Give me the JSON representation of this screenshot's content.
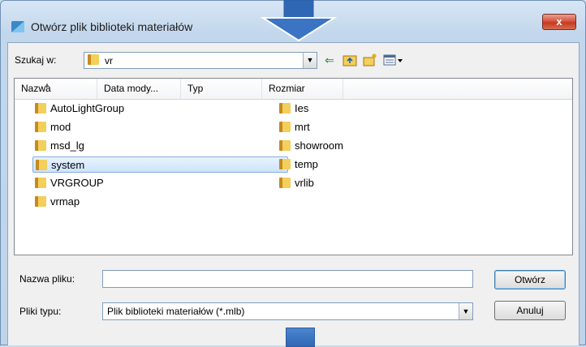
{
  "window": {
    "title": "Otwórz plik biblioteki materiałów",
    "close_label": "x"
  },
  "toolbar": {
    "lookin_label": "Szukaj w:",
    "lookin_value": "vr",
    "icons": [
      "back-arrow-icon",
      "up-folder-icon",
      "new-folder-icon",
      "view-menu-icon"
    ]
  },
  "file_list": {
    "columns": [
      "Nazwa",
      "Data mody...",
      "Typ",
      "Rozmiar"
    ],
    "items_left": [
      "AutoLightGroup",
      "mod",
      "msd_lg",
      "system",
      "VRGROUP",
      "vrmap"
    ],
    "items_right": [
      "Ies",
      "mrt",
      "showroom",
      "temp",
      "vrlib"
    ],
    "selected": "system"
  },
  "form": {
    "filename_label": "Nazwa pliku:",
    "filename_value": "",
    "filetype_label": "Pliki typu:",
    "filetype_value": "Plik biblioteki materiałów (*.mlb)",
    "open_button": "Otwórz",
    "cancel_button": "Anuluj"
  },
  "colors": {
    "accent": "#2f67b4",
    "selection": "#cde4fb",
    "close_button": "#c53a22"
  }
}
